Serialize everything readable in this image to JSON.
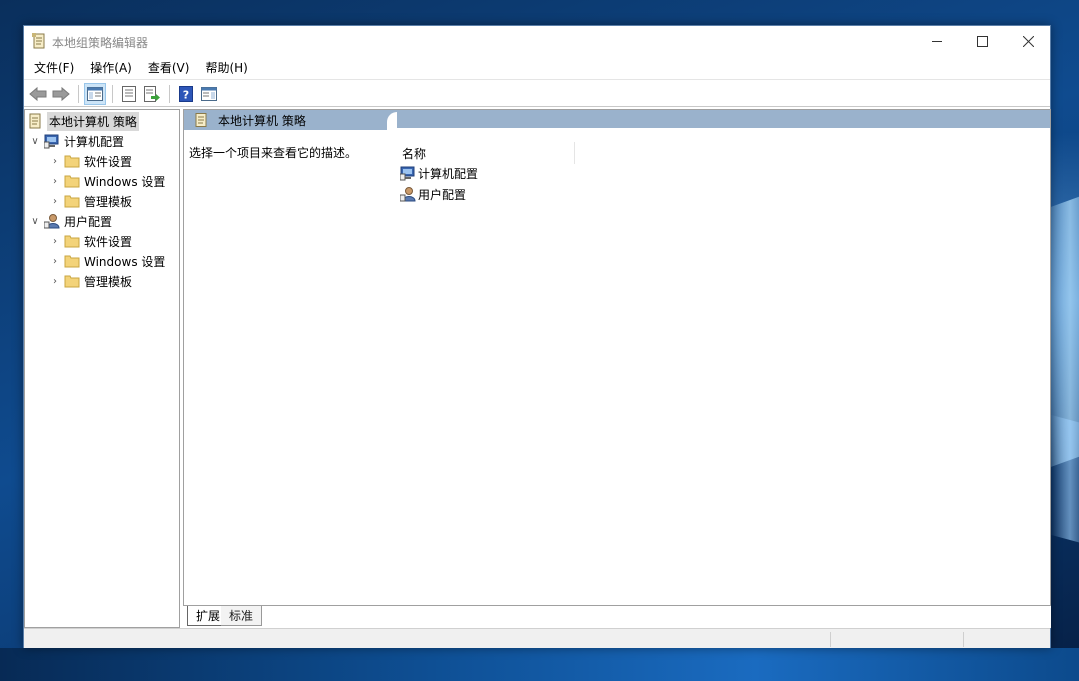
{
  "window": {
    "title": "本地组策略编辑器"
  },
  "menu": [
    {
      "label": "文件(F)"
    },
    {
      "label": "操作(A)"
    },
    {
      "label": "查看(V)"
    },
    {
      "label": "帮助(H)"
    }
  ],
  "toolbar": {
    "buttons": [
      "back-arrow-icon",
      "forward-arrow-icon",
      "show-hide-tree-icon",
      "properties-icon",
      "export-list-icon",
      "help-icon",
      "show-action-pane-icon"
    ]
  },
  "tree": {
    "root": "本地计算机 策略",
    "computer_config": "计算机配置",
    "computer_children": [
      "软件设置",
      "Windows 设置",
      "管理模板"
    ],
    "user_config": "用户配置",
    "user_children": [
      "软件设置",
      "Windows 设置",
      "管理模板"
    ]
  },
  "content": {
    "header": "本地计算机 策略",
    "description": "选择一个项目来查看它的描述。",
    "column_name": "名称",
    "items": [
      "计算机配置",
      "用户配置"
    ]
  },
  "tabs": [
    "扩展",
    "标准"
  ],
  "colors": {
    "header_bg": "#9ab2cc",
    "folder": "#f3d37a",
    "selection": "#d9d9d9"
  }
}
